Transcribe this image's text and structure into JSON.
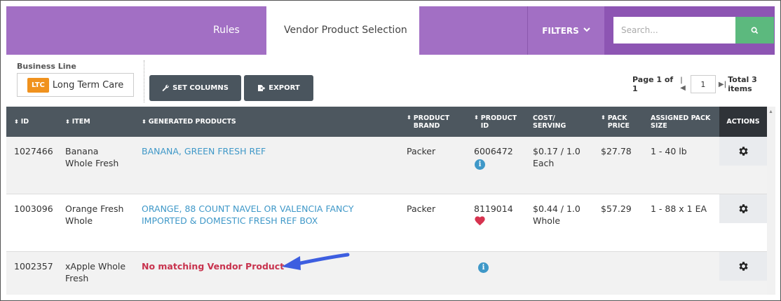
{
  "header": {
    "tab_rules": "Rules",
    "tab_vendor": "Vendor Product Selection",
    "filters_label": "FILTERS",
    "search_placeholder": "Search..."
  },
  "toolbar": {
    "business_line_label": "Business Line",
    "business_line_code": "LTC",
    "business_line_name": "Long Term Care",
    "set_columns_label": "SET COLUMNS",
    "export_label": "EXPORT"
  },
  "pager": {
    "page_text": "Page 1 of 1",
    "page_value": "1",
    "total_text": "Total 3 items"
  },
  "table": {
    "headers": {
      "id": "ID",
      "item": "ITEM",
      "generated_products": "GENERATED PRODUCTS",
      "product_brand_1": "PRODUCT",
      "product_brand_2": "BRAND",
      "product_id_1": "PRODUCT",
      "product_id_2": "ID",
      "cost_1": "COST/",
      "cost_2": "SERVING",
      "pack_price_1": "PACK",
      "pack_price_2": "PRICE",
      "assigned_1": "ASSIGNED PACK",
      "assigned_2": "SIZE",
      "actions": "ACTIONS"
    },
    "rows": [
      {
        "id": "1027466",
        "item_1": "Banana",
        "item_2": "Whole Fresh",
        "product_1": "BANANA, GREEN FRESH REF",
        "product_2": "",
        "brand": "Packer",
        "product_id": "6006472",
        "product_id_icon": "info-icon",
        "cost_1": "$0.17 / 1.0",
        "cost_2": "Each",
        "pack_price": "$27.78",
        "assigned": "1 - 40 lb"
      },
      {
        "id": "1003096",
        "item_1": "Orange Fresh",
        "item_2": "Whole",
        "product_1": "ORANGE, 88 COUNT NAVEL OR VALENCIA FANCY",
        "product_2": "IMPORTED & DOMESTIC FRESH REF BOX",
        "brand": "Packer",
        "product_id": "8119014",
        "product_id_icon": "heart-icon",
        "cost_1": "$0.44 / 1.0",
        "cost_2": "Whole",
        "pack_price": "$57.29",
        "assigned": "1 - 88 x 1 EA"
      },
      {
        "id": "1002357",
        "item_1": "xApple Whole",
        "item_2": "Fresh",
        "no_match": "No matching Vendor Product",
        "brand": "",
        "product_id": "",
        "product_id_icon": "info-icon",
        "cost_1": "",
        "cost_2": "",
        "pack_price": "",
        "assigned": ""
      }
    ]
  },
  "colors": {
    "purple": "#a26fc4",
    "purple_dark": "#8d55b3",
    "green": "#5cb97e",
    "header_gray": "#4d575f",
    "link_blue": "#3f98c8",
    "alert_red": "#c8334e",
    "ltc_orange": "#f0921e",
    "arrow_blue": "#3d5ee0"
  }
}
